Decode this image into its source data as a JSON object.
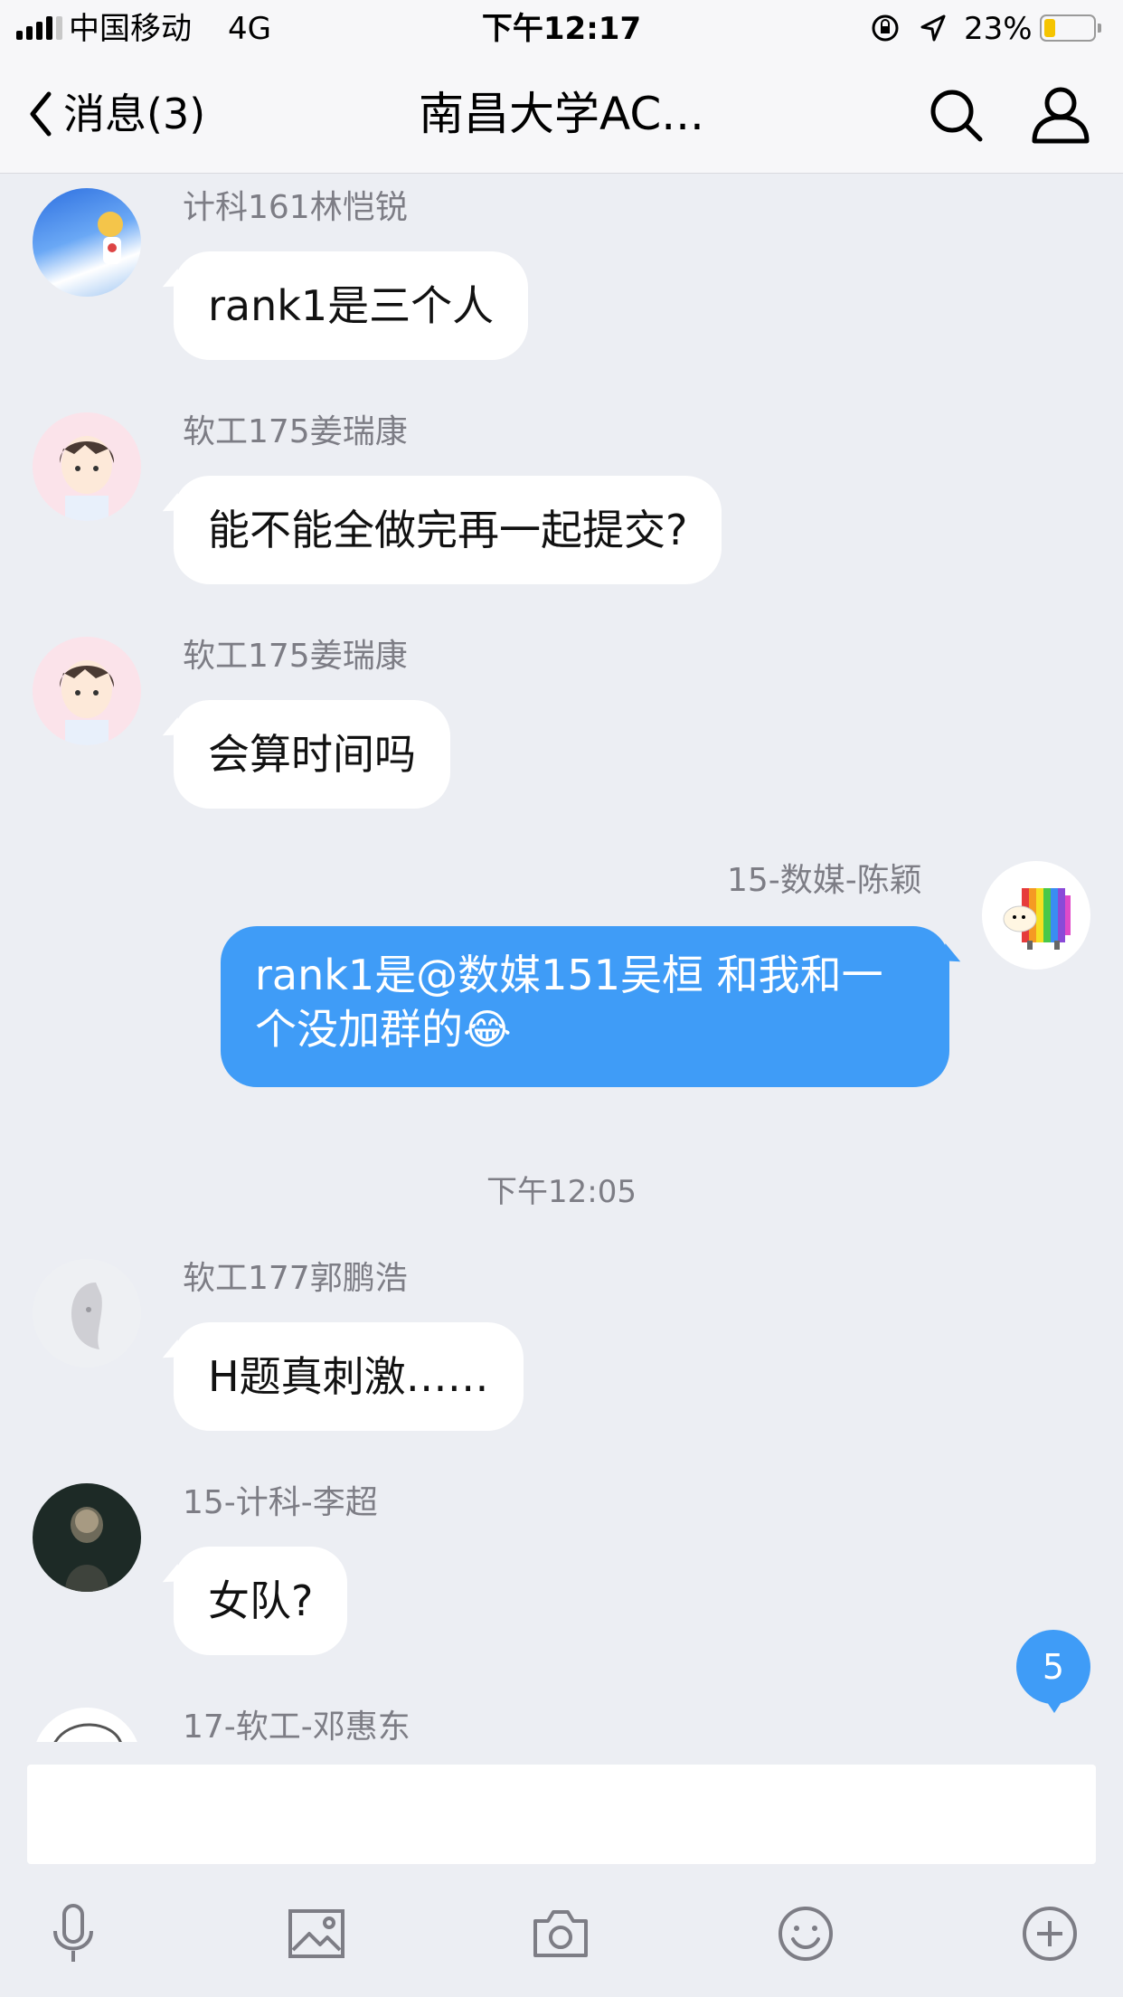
{
  "status_bar": {
    "carrier": "中国移动",
    "network": "4G",
    "time": "下午12:17",
    "battery_percent": "23%",
    "battery_level": 0.23
  },
  "nav": {
    "back_label": "消息(3)",
    "title": "南昌大学AC..."
  },
  "messages": [
    {
      "sender": "计科161林恺锐",
      "text": "rank1是三个人"
    },
    {
      "sender": "软工175姜瑞康",
      "text": "能不能全做完再一起提交?"
    },
    {
      "sender": "软工175姜瑞康",
      "text": "会算时间吗"
    },
    {
      "sender": "15-数媒-陈颖",
      "text": "rank1是@数媒151吴桓 和我和一个没加群的😂"
    },
    {
      "sender": "软工177郭鹏浩",
      "text": "H题真刺激……"
    },
    {
      "sender": "15-计科-李超",
      "text": "女队?"
    },
    {
      "sender": "17-软工-邓惠东",
      "text": ""
    }
  ],
  "timestamp": "下午12:05",
  "unread_badge": "5",
  "input": {
    "value": "",
    "placeholder": ""
  },
  "toolbar": [
    "microphone-icon",
    "image-icon",
    "camera-icon",
    "emoji-icon",
    "plus-icon"
  ],
  "colors": {
    "outgoing_bubble": "#3f9cf7",
    "background": "#eceef3",
    "incoming_bubble": "#ffffff"
  }
}
